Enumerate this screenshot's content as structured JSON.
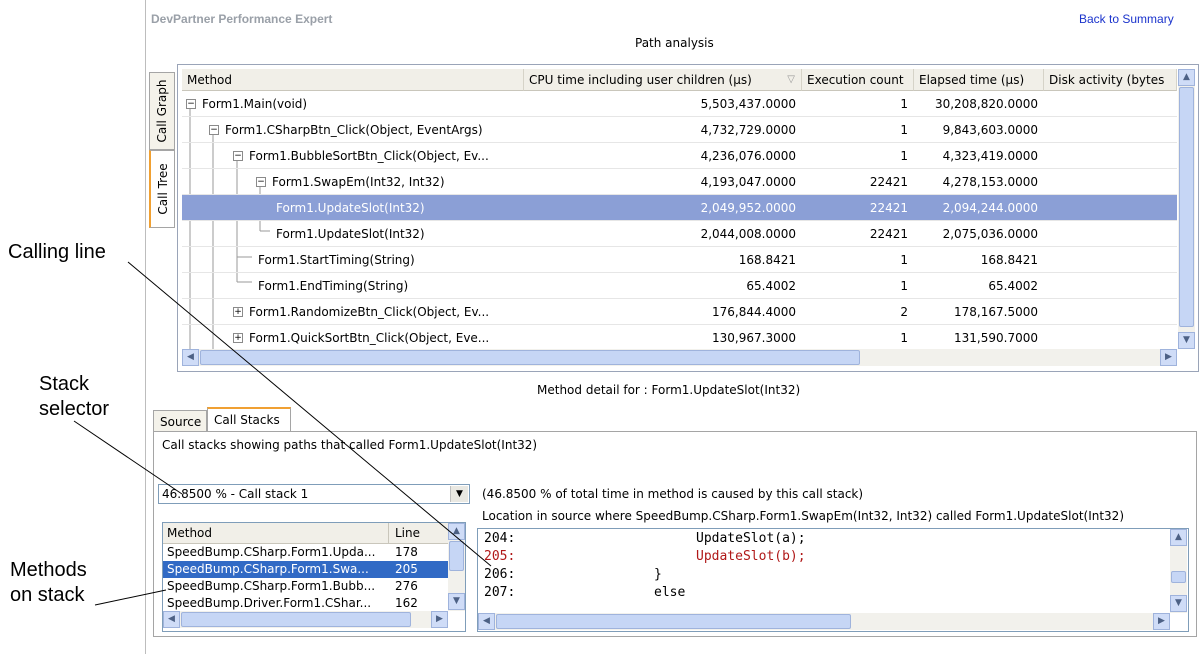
{
  "callouts": {
    "calling_line": "Calling line",
    "stack_selector": "Stack\nselector",
    "methods_on_stack": "Methods\non stack"
  },
  "app": {
    "title": "DevPartner Performance Expert",
    "back_link": "Back to Summary",
    "section_title": "Path analysis"
  },
  "side_tabs": {
    "call_graph": "Call Graph",
    "call_tree": "Call Tree"
  },
  "tree": {
    "columns": [
      "Method",
      "CPU time including user children (µs)",
      "Execution count",
      "Elapsed time (µs)",
      "Disk activity (bytes"
    ],
    "rows": [
      {
        "method": "Form1.Main(void)",
        "cpu": "5,503,437.0000",
        "count": "1",
        "elapsed": "30,208,820.0000",
        "expander": "−"
      },
      {
        "method": "Form1.CSharpBtn_Click(Object, EventArgs)",
        "cpu": "4,732,729.0000",
        "count": "1",
        "elapsed": "9,843,603.0000",
        "expander": "−"
      },
      {
        "method": "Form1.BubbleSortBtn_Click(Object,  Ev...",
        "cpu": "4,236,076.0000",
        "count": "1",
        "elapsed": "4,323,419.0000",
        "expander": "−"
      },
      {
        "method": "Form1.SwapEm(Int32, Int32)",
        "cpu": "4,193,047.0000",
        "count": "22421",
        "elapsed": "4,278,153.0000",
        "expander": "−"
      },
      {
        "method": "Form1.UpdateSlot(Int32)",
        "cpu": "2,049,952.0000",
        "count": "22421",
        "elapsed": "2,094,244.0000",
        "expander": ""
      },
      {
        "method": "Form1.UpdateSlot(Int32)",
        "cpu": "2,044,008.0000",
        "count": "22421",
        "elapsed": "2,075,036.0000",
        "expander": ""
      },
      {
        "method": "Form1.StartTiming(String)",
        "cpu": "168.8421",
        "count": "1",
        "elapsed": "168.8421",
        "expander": ""
      },
      {
        "method": "Form1.EndTiming(String)",
        "cpu": "65.4002",
        "count": "1",
        "elapsed": "65.4002",
        "expander": ""
      },
      {
        "method": "Form1.RandomizeBtn_Click(Object,  Ev...",
        "cpu": "176,844.4000",
        "count": "2",
        "elapsed": "178,167.5000",
        "expander": "+"
      },
      {
        "method": "Form1.QuickSortBtn_Click(Object,  Eve...",
        "cpu": "130,967.3000",
        "count": "1",
        "elapsed": "131,590.7000",
        "expander": "+"
      }
    ]
  },
  "detail": {
    "title": "Method detail for : Form1.UpdateSlot(Int32)",
    "tabs": [
      "Source",
      "Call Stacks"
    ],
    "description": "Call stacks showing paths that called Form1.UpdateSlot(Int32)",
    "stack_select_value": "46.8500 % - Call stack 1",
    "pct_note": "(46.8500 % of total time in method is caused by this call stack)",
    "location_note": "Location in source where SpeedBump.CSharp.Form1.SwapEm(Int32, Int32) called Form1.UpdateSlot(Int32)",
    "stack_columns": [
      "Method",
      "Line"
    ],
    "stack_rows": [
      {
        "method": "SpeedBump.CSharp.Form1.Upda...",
        "line": "178"
      },
      {
        "method": "SpeedBump.CSharp.Form1.Swa...",
        "line": "205"
      },
      {
        "method": "SpeedBump.CSharp.Form1.Bubb...",
        "line": "276"
      },
      {
        "method": "SpeedBump.Driver.Form1.CShar...",
        "line": "162"
      }
    ],
    "source_lines": [
      {
        "num": "204:",
        "code": "UpdateSlot(a);"
      },
      {
        "num": "205:",
        "code": "UpdateSlot(b);"
      },
      {
        "num": "206:",
        "code": "}"
      },
      {
        "num": "207:",
        "code": "else"
      }
    ]
  },
  "colors": {
    "selected_row": "#8b9fd6",
    "highlight_code": "#b01818",
    "link": "#1a33cc",
    "tab_accent": "#f0a032"
  }
}
